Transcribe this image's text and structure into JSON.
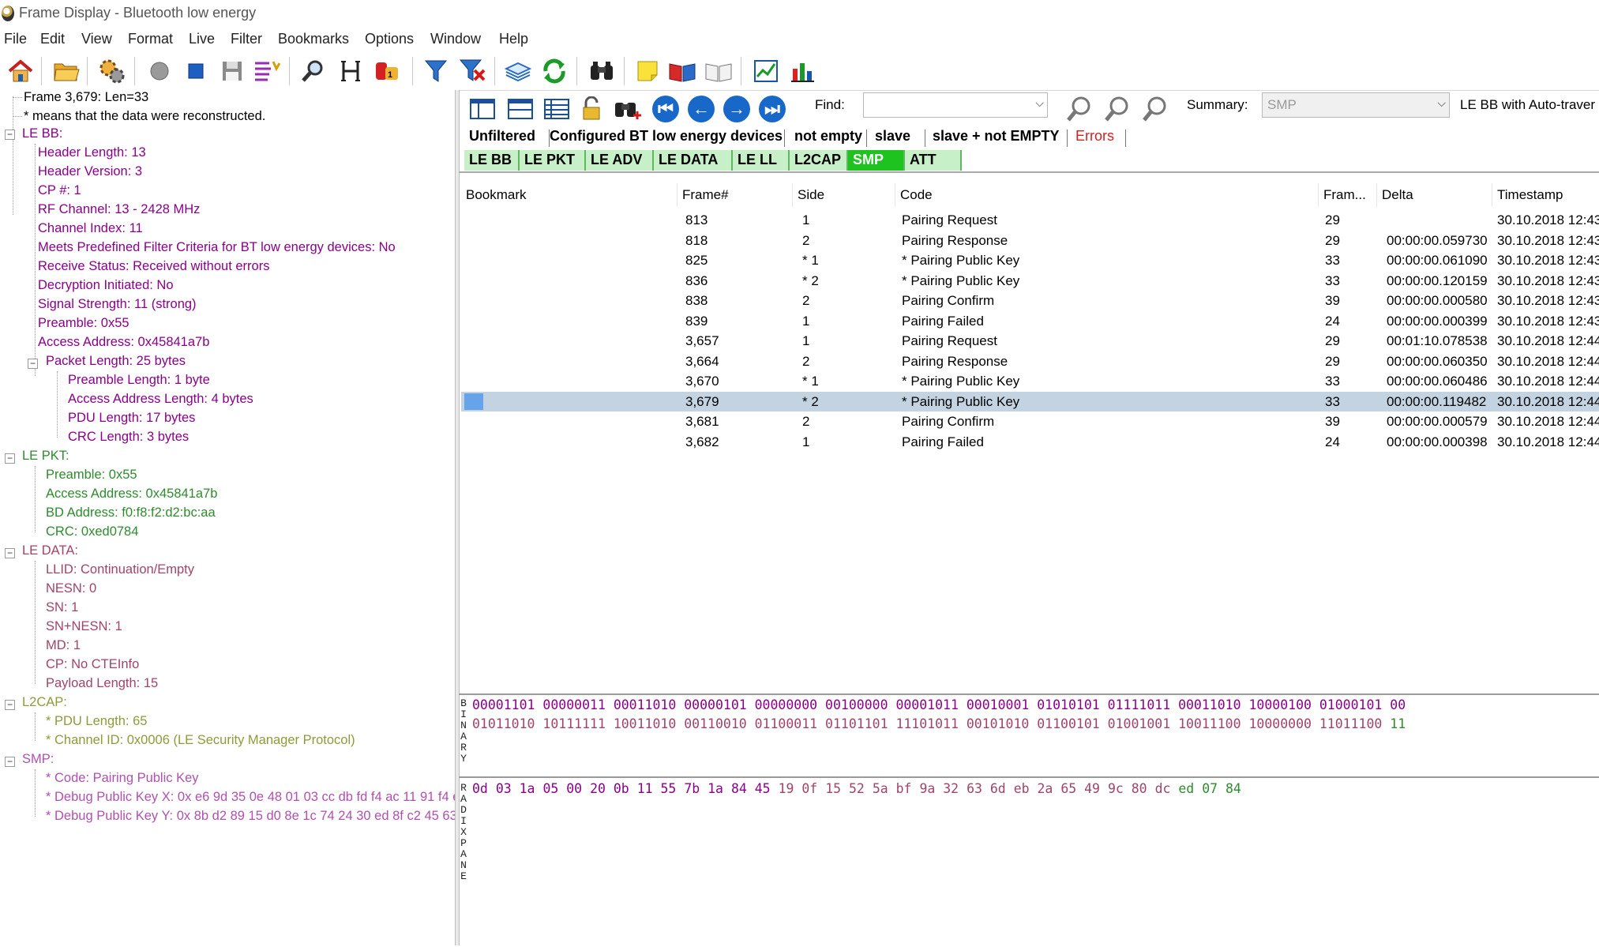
{
  "window": {
    "title": "Frame Display - Bluetooth low energy"
  },
  "menu": [
    "File",
    "Edit",
    "View",
    "Format",
    "Live",
    "Filter",
    "Bookmarks",
    "Options",
    "Window",
    "Help"
  ],
  "toolbar_icons": [
    "home-icon",
    "open-folder-icon",
    "gears-icon",
    "record-icon",
    "stop-icon",
    "save-icon",
    "sparkle-filter-icon",
    "search-icon",
    "columns-icon",
    "decode-icon",
    "filter-icon",
    "filter-clear-icon",
    "layers-icon",
    "refresh-icon",
    "binoculars-icon",
    "sticky-note-icon",
    "book-open-icon",
    "book-blank-icon",
    "line-chart-icon",
    "bar-chart-icon"
  ],
  "tree": {
    "header": {
      "frame": "Frame 3,679:  Len=33",
      "note_marker": "*",
      "note": "means that the data were reconstructed."
    },
    "colors": {
      "lebb": "#8b008b",
      "lepkt": "#2e8b2e",
      "ledata": "#a0446a",
      "l2cap": "#8f9a3a",
      "smp": "#b050b0"
    },
    "le_bb": {
      "label": "LE BB:",
      "items": [
        "Header Length: 13",
        "Header Version: 3",
        "CP #: 1",
        "RF Channel: 13 - 2428 MHz",
        "Channel Index: 11",
        "Meets Predefined Filter Criteria for BT low energy devices: No",
        "Receive Status: Received without errors",
        "Decryption Initiated: No",
        "Signal Strength: 11 (strong)",
        "Preamble: 0x55",
        "Access Address: 0x45841a7b"
      ],
      "packet_length": "Packet Length: 25  bytes",
      "packet_items": [
        "Preamble Length: 1 byte",
        "Access Address Length: 4 bytes",
        "PDU Length: 17 bytes",
        "CRC Length: 3 bytes"
      ]
    },
    "le_pkt": {
      "label": "LE PKT:",
      "items": [
        "Preamble: 0x55",
        "Access Address: 0x45841a7b",
        "BD Address: f0:f8:f2:d2:bc:aa",
        "CRC: 0xed0784"
      ]
    },
    "le_data": {
      "label": "LE DATA:",
      "items": [
        "LLID: Continuation/Empty",
        "NESN: 0",
        "SN: 1",
        "SN+NESN: 1",
        "MD: 1",
        "CP: No CTEInfo",
        "Payload Length: 15"
      ]
    },
    "l2cap": {
      "label": "L2CAP:",
      "items": [
        "PDU Length: 65",
        "Channel ID: 0x0006  (LE Security Manager Protocol)"
      ]
    },
    "smp": {
      "label": "SMP:",
      "items": [
        "Code: Pairing Public Key",
        "Debug Public Key X: 0x e6 9d 35 0e 48 01 03 cc db fd f4 ac 11 91 f4 e",
        "Debug Public Key Y: 0x 8b d2 89 15 d0 8e 1c 74 24 30 ed 8f c2 45 63"
      ]
    }
  },
  "find": {
    "label": "Find:",
    "value": ""
  },
  "summary": {
    "label": "Summary:",
    "value": "SMP",
    "after": "LE BB with Auto-traver"
  },
  "filters": [
    "Unfiltered",
    "Configured BT low energy devices",
    "not empty",
    "slave",
    "slave + not EMPTY",
    "Errors"
  ],
  "protocol_tabs": [
    "LE BB",
    "LE PKT",
    "LE ADV",
    "LE DATA",
    "LE LL",
    "L2CAP",
    "SMP",
    "ATT"
  ],
  "active_protocol_tab": "SMP",
  "table": {
    "columns": [
      "Bookmark",
      "Frame#",
      "Side",
      "Code",
      "Fram...",
      "Delta",
      "Timestamp"
    ],
    "rows": [
      {
        "frame": "813",
        "side": "1",
        "code": "Pairing Request",
        "len": "29",
        "delta": "",
        "ts": "30.10.2018 12:43"
      },
      {
        "frame": "818",
        "side": "2",
        "code": "Pairing Response",
        "len": "29",
        "delta": "00:00:00.059730",
        "ts": "30.10.2018 12:43"
      },
      {
        "frame": "825",
        "side": "* 1",
        "code": "* Pairing Public Key",
        "len": "33",
        "delta": "00:00:00.061090",
        "ts": "30.10.2018 12:43"
      },
      {
        "frame": "836",
        "side": "* 2",
        "code": "* Pairing Public Key",
        "len": "33",
        "delta": "00:00:00.120159",
        "ts": "30.10.2018 12:43"
      },
      {
        "frame": "838",
        "side": "2",
        "code": "Pairing Confirm",
        "len": "39",
        "delta": "00:00:00.000580",
        "ts": "30.10.2018 12:43"
      },
      {
        "frame": "839",
        "side": "1",
        "code": "Pairing Failed",
        "len": "24",
        "delta": "00:00:00.000399",
        "ts": "30.10.2018 12:43"
      },
      {
        "frame": "3,657",
        "side": "1",
        "code": "Pairing Request",
        "len": "29",
        "delta": "00:01:10.078538",
        "ts": "30.10.2018 12:44"
      },
      {
        "frame": "3,664",
        "side": "2",
        "code": "Pairing Response",
        "len": "29",
        "delta": "00:00:00.060350",
        "ts": "30.10.2018 12:44"
      },
      {
        "frame": "3,670",
        "side": "* 1",
        "code": "* Pairing Public Key",
        "len": "33",
        "delta": "00:00:00.060486",
        "ts": "30.10.2018 12:44"
      },
      {
        "frame": "3,679",
        "side": "* 2",
        "code": "* Pairing Public Key",
        "len": "33",
        "delta": "00:00:00.119482",
        "ts": "30.10.2018 12:44"
      },
      {
        "frame": "3,681",
        "side": "2",
        "code": "Pairing Confirm",
        "len": "39",
        "delta": "00:00:00.000579",
        "ts": "30.10.2018 12:44"
      },
      {
        "frame": "3,682",
        "side": "1",
        "code": "Pairing Failed",
        "len": "24",
        "delta": "00:00:00.000398",
        "ts": "30.10.2018 12:44"
      }
    ],
    "selected_frame": "3,679"
  },
  "binary_pane": {
    "title": "BINARY",
    "row1": [
      [
        "00001101",
        "#8b008b"
      ],
      [
        "00000011",
        "#8b008b"
      ],
      [
        "00011010",
        "#8b008b"
      ],
      [
        "00000101",
        "#8b008b"
      ],
      [
        "00000000",
        "#8b008b"
      ],
      [
        "00100000",
        "#8b008b"
      ],
      [
        "00001011",
        "#8b008b"
      ],
      [
        "00010001",
        "#8b008b"
      ],
      [
        "01010101",
        "#8b008b"
      ],
      [
        "01111011",
        "#8b008b"
      ],
      [
        "00011010",
        "#8b008b"
      ],
      [
        "10000100",
        "#8b008b"
      ],
      [
        "01000101",
        "#8b008b"
      ],
      [
        "00",
        "#8b008b"
      ]
    ],
    "row2": [
      [
        "01011010",
        "#a0446a"
      ],
      [
        "10111111",
        "#a0446a"
      ],
      [
        "10011010",
        "#a0446a"
      ],
      [
        "00110010",
        "#a0446a"
      ],
      [
        "01100011",
        "#a0446a"
      ],
      [
        "01101101",
        "#a0446a"
      ],
      [
        "11101011",
        "#a0446a"
      ],
      [
        "00101010",
        "#a0446a"
      ],
      [
        "01100101",
        "#a0446a"
      ],
      [
        "01001001",
        "#a0446a"
      ],
      [
        "10011100",
        "#a0446a"
      ],
      [
        "10000000",
        "#a0446a"
      ],
      [
        "11011100",
        "#a0446a"
      ],
      [
        "11",
        "#2e8b2e"
      ]
    ]
  },
  "radix_pane": {
    "title": "RADIX PANE",
    "bytes": [
      [
        "0d",
        "#8b008b"
      ],
      [
        "03",
        "#8b008b"
      ],
      [
        "1a",
        "#8b008b"
      ],
      [
        "05",
        "#8b008b"
      ],
      [
        "00",
        "#8b008b"
      ],
      [
        "20",
        "#8b008b"
      ],
      [
        "0b",
        "#8b008b"
      ],
      [
        "11",
        "#8b008b"
      ],
      [
        "55",
        "#8b008b"
      ],
      [
        "7b",
        "#8b008b"
      ],
      [
        "1a",
        "#8b008b"
      ],
      [
        "84",
        "#8b008b"
      ],
      [
        "45",
        "#8b008b"
      ],
      [
        "19",
        "#a0446a"
      ],
      [
        "0f",
        "#a0446a"
      ],
      [
        "15",
        "#a0446a"
      ],
      [
        "52",
        "#a0446a"
      ],
      [
        "5a",
        "#a0446a"
      ],
      [
        "bf",
        "#a0446a"
      ],
      [
        "9a",
        "#a0446a"
      ],
      [
        "32",
        "#a0446a"
      ],
      [
        "63",
        "#a0446a"
      ],
      [
        "6d",
        "#a0446a"
      ],
      [
        "eb",
        "#a0446a"
      ],
      [
        "2a",
        "#a0446a"
      ],
      [
        "65",
        "#a0446a"
      ],
      [
        "49",
        "#a0446a"
      ],
      [
        "9c",
        "#a0446a"
      ],
      [
        "80",
        "#a0446a"
      ],
      [
        "dc",
        "#a0446a"
      ],
      [
        "ed",
        "#2e8b2e"
      ],
      [
        "07",
        "#2e8b2e"
      ],
      [
        "84",
        "#2e8b2e"
      ]
    ]
  }
}
